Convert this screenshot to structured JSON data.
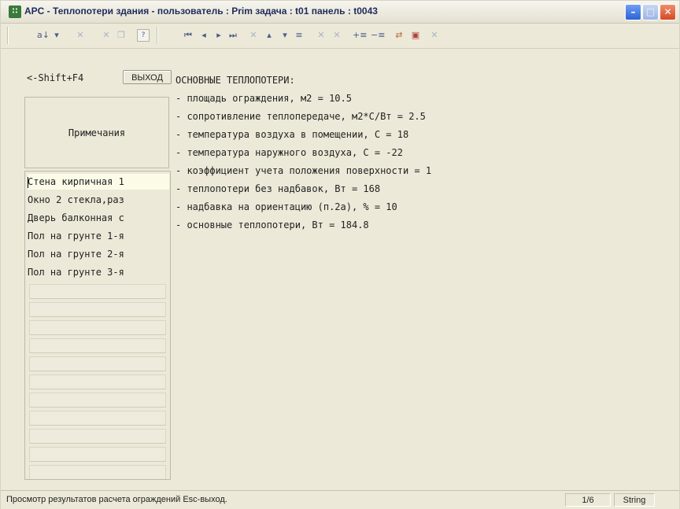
{
  "window": {
    "title": "APC - Теплопотери здания -   пользователь : Prim  задача : t01  панель : t0043"
  },
  "toolbar": {
    "icons": [
      "sort-icon",
      "dropdown-icon",
      "delete-icon",
      "cut-icon",
      "copy-icon",
      "help-icon",
      "first-record-icon",
      "prev-record-icon",
      "next-record-icon",
      "last-record-icon",
      "cancel-icon",
      "move-up-icon",
      "move-down-icon",
      "sum-icon",
      "clear-icon",
      "clear2-icon",
      "add-column-icon",
      "remove-column-icon",
      "swap-icon",
      "save-icon",
      "close-doc-icon"
    ]
  },
  "controls": {
    "shift_label": "<-Shift+F4",
    "exit_label": "ВЫХОД"
  },
  "notes_header": "Примечания",
  "rows": [
    "Стена кирпичная 1",
    "Окно 2 стекла,раз",
    "Дверь балконная с",
    "Пол на грунте 1-я",
    "Пол на грунте 2-я",
    "Пол на грунте 3-я"
  ],
  "selected_row": 0,
  "empty_rows": 11,
  "results": {
    "heading": "ОСНОВНЫЕ ТЕПЛОПОТЕРИ:",
    "lines": [
      "- площадь ограждения, м2 = 10.5",
      "- сопротивление теплопередаче, м2*С/Вт = 2.5",
      "- температура воздуха в помещении, С = 18",
      "- температура наружного воздуха, С = -22",
      "- коэффициент учета положения поверхности = 1",
      "- теплопотери без надбавок, Вт = 168",
      "- надбавка на ориентацию (п.2а), % = 10",
      "- основные теплопотери, Вт = 184.8"
    ]
  },
  "statusbar": {
    "message": "Просмотр результатов расчета ограждений  Esc-выход.",
    "position": "1/6",
    "type": "String"
  }
}
